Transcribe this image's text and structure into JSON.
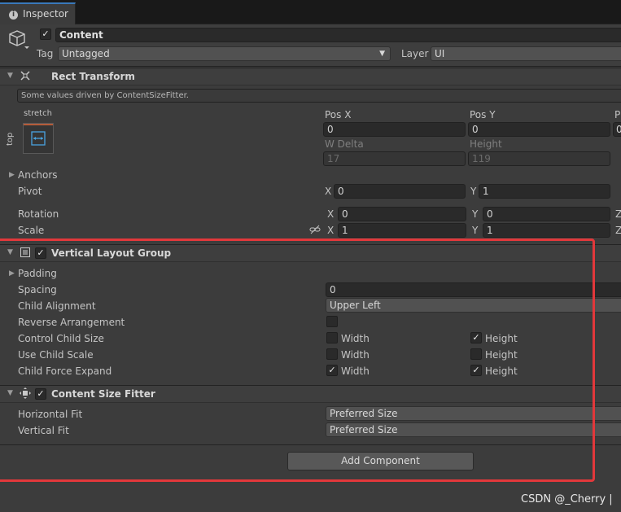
{
  "tab": {
    "label": "Inspector",
    "icon": "info-icon"
  },
  "object": {
    "name": "Content",
    "active": true,
    "tag_label": "Tag",
    "tag_value": "Untagged",
    "layer_label": "Layer",
    "layer_value": "UI"
  },
  "rect_transform": {
    "title": "Rect Transform",
    "driven_note": "Some values driven by ContentSizeFitter.",
    "anchor_preset_h": "stretch",
    "anchor_preset_v": "top",
    "pos_x_label": "Pos X",
    "pos_x": "0",
    "pos_y_label": "Pos Y",
    "pos_y": "0",
    "pos_z_label_partial": "P",
    "pos_z_partial": "0",
    "w_delta_label": "W Delta",
    "w_delta": "17",
    "height_label": "Height",
    "height": "119",
    "anchors_label": "Anchors",
    "pivot_label": "Pivot",
    "pivot_x": "0",
    "pivot_y": "1",
    "rotation_label": "Rotation",
    "rotation_x": "0",
    "rotation_y": "0",
    "scale_label": "Scale",
    "scale_x": "1",
    "scale_y": "1",
    "x_label": "X",
    "y_label": "Y",
    "z_label": "Z"
  },
  "vertical_layout_group": {
    "title": "Vertical Layout Group",
    "enabled": true,
    "padding_label": "Padding",
    "spacing_label": "Spacing",
    "spacing": "0",
    "child_alignment_label": "Child Alignment",
    "child_alignment": "Upper Left",
    "reverse_label": "Reverse Arrangement",
    "reverse": false,
    "control_child_size_label": "Control Child Size",
    "control_width": false,
    "control_height": true,
    "use_child_scale_label": "Use Child Scale",
    "scale_width": false,
    "scale_height": false,
    "child_force_expand_label": "Child Force Expand",
    "expand_width": true,
    "expand_height": true,
    "width_label": "Width",
    "height_label": "Height"
  },
  "content_size_fitter": {
    "title": "Content Size Fitter",
    "enabled": true,
    "horizontal_fit_label": "Horizontal Fit",
    "horizontal_fit": "Preferred Size",
    "vertical_fit_label": "Vertical Fit",
    "vertical_fit": "Preferred Size"
  },
  "add_component_label": "Add Component",
  "watermark": "CSDN @_Cherry |",
  "colors": {
    "highlight": "#e2383b",
    "tab_accent": "#3a79bb",
    "panel": "#3c3c3c"
  }
}
